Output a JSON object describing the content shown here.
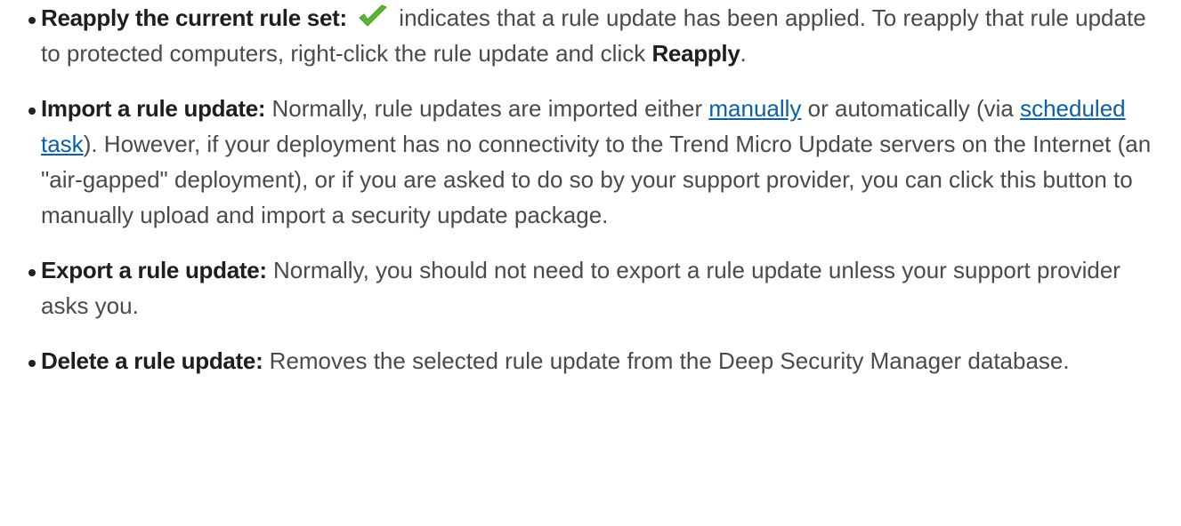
{
  "items": [
    {
      "term": "Reapply the current rule set:",
      "icon": "checkmark-icon",
      "text_a": " indicates that a rule update has been applied. To reapply that rule update to protected computers, right-click the rule update and click ",
      "bold_b": "Reapply",
      "text_c": "."
    },
    {
      "term": "Import a rule update:",
      "text_a": " Normally, rule updates are imported either ",
      "link_1": "manually",
      "text_b": " or automatically (via ",
      "link_2": "scheduled task",
      "text_c": "). However, if your deployment has no connectivity to the Trend Micro Update servers on the Internet (an \"air-gapped\" deployment), or if you are asked to do so by your support provider, you can click this button to manually upload and import a security update package."
    },
    {
      "term": "Export a rule update:",
      "text_a": " Normally, you should not need to export a rule update unless your support provider asks you."
    },
    {
      "term": "Delete a rule update:",
      "text_a": " Removes the selected rule update from the Deep Security Manager database."
    }
  ],
  "colors": {
    "check": "#5cb531",
    "link": "#0b5fa5",
    "text": "#4a4a4a",
    "term": "#1e1e1e"
  }
}
